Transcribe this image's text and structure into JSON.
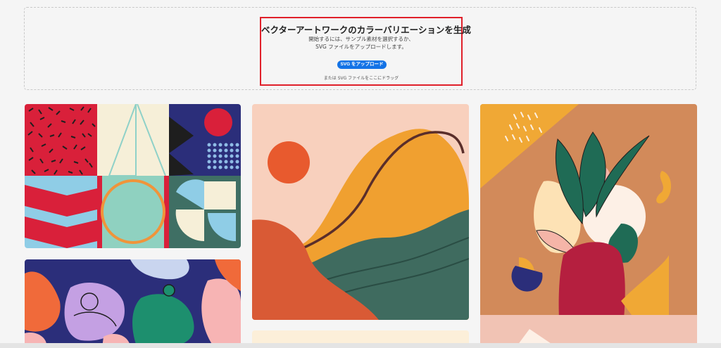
{
  "upload": {
    "title": "ベクターアートワークのカラーバリエーションを生成",
    "description_line1": "開始するには、サンプル素材を選択するか、",
    "description_line2": "SVG ファイルをアップロードします。",
    "button_label": "SVG をアップロード",
    "drag_hint": "または SVG ファイルをここにドラッグ"
  },
  "gallery": {
    "cards": [
      {
        "name": "geometric-pattern-sample"
      },
      {
        "name": "people-pattern-sample"
      },
      {
        "name": "abstract-landscape-sample"
      },
      {
        "name": "warm-sample-thumbnail"
      },
      {
        "name": "botanical-vase-sample"
      }
    ]
  },
  "colors": {
    "accent": "#1473e6",
    "highlight": "#e0202a",
    "background": "#f5f5f5"
  }
}
